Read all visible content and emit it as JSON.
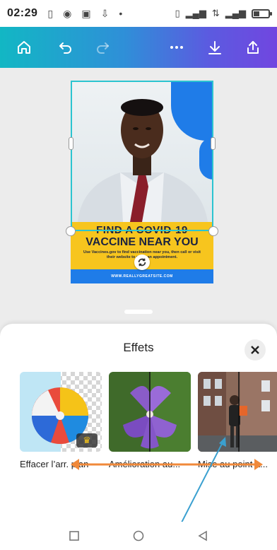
{
  "status_bar": {
    "time": "02:29",
    "icons": [
      "sim-icon",
      "chrome-icon",
      "game-icon",
      "download-icon",
      "dot-icon"
    ],
    "right_icons": [
      "vibrate-icon",
      "signal-icon",
      "data-icon",
      "battery-icon"
    ]
  },
  "toolbar": {
    "buttons": [
      {
        "name": "home-button",
        "icon": "home-icon"
      },
      {
        "name": "undo-button",
        "icon": "undo-icon"
      },
      {
        "name": "redo-button",
        "icon": "redo-icon",
        "disabled": true
      },
      {
        "name": "more-button",
        "icon": "more-icon"
      },
      {
        "name": "download-button",
        "icon": "download-icon"
      },
      {
        "name": "share-button",
        "icon": "share-icon"
      }
    ]
  },
  "design": {
    "headline_line1": "FIND A COVID-19",
    "headline_line2": "VACCINE NEAR YOU",
    "body_text": "Use Vaccines.gov to find vaccination near you, then call or visit their website to make an appointment.",
    "footer_url": "WWW.REALLYGREATSITE.COM",
    "colors": {
      "yellow": "#f7c51e",
      "blue": "#1f7ce8",
      "navy": "#1c2340",
      "selection": "#2bc4d0"
    }
  },
  "sheet": {
    "title": "Effets",
    "close_icon": "close-icon",
    "effects": [
      {
        "name": "background-remover",
        "label": "Effacer l’arr. plan",
        "badge": "crown-icon"
      },
      {
        "name": "enhance",
        "label": "Amélioration au..."
      },
      {
        "name": "focus",
        "label": "Mise au point a..."
      }
    ]
  },
  "annotations": {
    "horizontal_arrow_color": "#f0893a",
    "diagonal_arrow_color": "#3aa0d0"
  },
  "navbar": {
    "icons": [
      "square-icon",
      "circle-icon",
      "triangle-icon"
    ]
  }
}
